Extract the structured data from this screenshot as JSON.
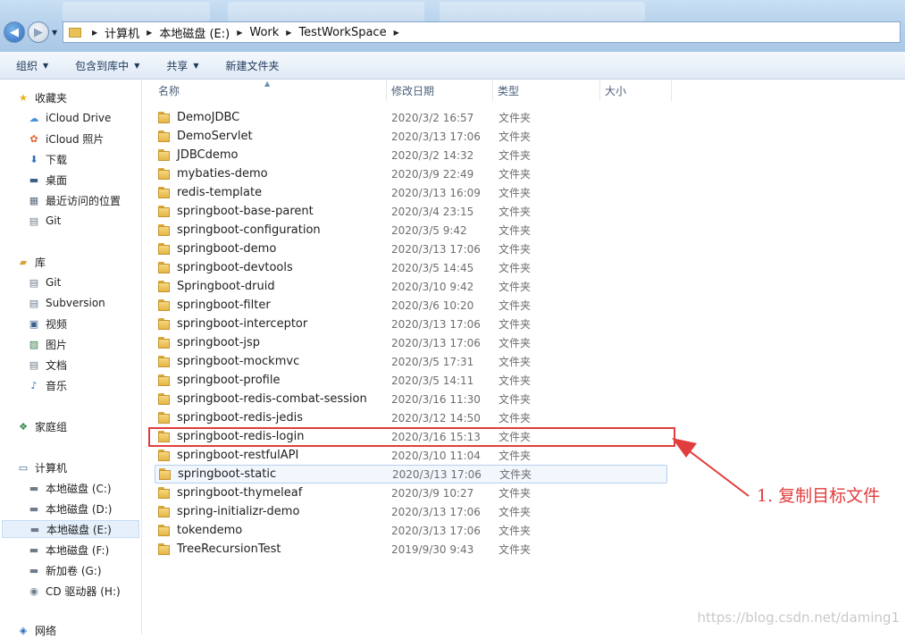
{
  "address_bar": {
    "crumbs": [
      "计算机",
      "本地磁盘 (E:)",
      "Work",
      "TestWorkSpace"
    ]
  },
  "toolbar": {
    "organize": "组织",
    "include_in_library": "包含到库中",
    "share": "共享",
    "new_folder": "新建文件夹"
  },
  "sidebar": {
    "favorites": {
      "label": "收藏夹",
      "items": [
        "iCloud Drive",
        "iCloud 照片",
        "下载",
        "桌面",
        "最近访问的位置",
        "Git"
      ]
    },
    "libraries": {
      "label": "库",
      "items": [
        "Git",
        "Subversion",
        "视频",
        "图片",
        "文档",
        "音乐"
      ]
    },
    "homegroup": {
      "label": "家庭组"
    },
    "computer": {
      "label": "计算机",
      "items": [
        "本地磁盘 (C:)",
        "本地磁盘 (D:)",
        "本地磁盘 (E:)",
        "本地磁盘 (F:)",
        "新加卷 (G:)",
        "CD 驱动器 (H:)"
      ],
      "selected": "本地磁盘 (E:)"
    },
    "network": {
      "label": "网络"
    }
  },
  "columns": {
    "name": "名称",
    "modified": "修改日期",
    "type": "类型",
    "size": "大小"
  },
  "files": [
    {
      "name": "DemoJDBC",
      "modified": "2020/3/2 16:57",
      "type": "文件夹"
    },
    {
      "name": "DemoServlet",
      "modified": "2020/3/13 17:06",
      "type": "文件夹"
    },
    {
      "name": "JDBCdemo",
      "modified": "2020/3/2 14:32",
      "type": "文件夹"
    },
    {
      "name": "mybaties-demo",
      "modified": "2020/3/9 22:49",
      "type": "文件夹"
    },
    {
      "name": "redis-template",
      "modified": "2020/3/13 16:09",
      "type": "文件夹"
    },
    {
      "name": "springboot-base-parent",
      "modified": "2020/3/4 23:15",
      "type": "文件夹"
    },
    {
      "name": "springboot-configuration",
      "modified": "2020/3/5 9:42",
      "type": "文件夹"
    },
    {
      "name": "springboot-demo",
      "modified": "2020/3/13 17:06",
      "type": "文件夹"
    },
    {
      "name": "springboot-devtools",
      "modified": "2020/3/5 14:45",
      "type": "文件夹"
    },
    {
      "name": "Springboot-druid",
      "modified": "2020/3/10 9:42",
      "type": "文件夹"
    },
    {
      "name": "springboot-filter",
      "modified": "2020/3/6 10:20",
      "type": "文件夹"
    },
    {
      "name": "springboot-interceptor",
      "modified": "2020/3/13 17:06",
      "type": "文件夹"
    },
    {
      "name": "springboot-jsp",
      "modified": "2020/3/13 17:06",
      "type": "文件夹"
    },
    {
      "name": "springboot-mockmvc",
      "modified": "2020/3/5 17:31",
      "type": "文件夹"
    },
    {
      "name": "springboot-profile",
      "modified": "2020/3/5 14:11",
      "type": "文件夹"
    },
    {
      "name": "springboot-redis-combat-session",
      "modified": "2020/3/16 11:30",
      "type": "文件夹"
    },
    {
      "name": "springboot-redis-jedis",
      "modified": "2020/3/12 14:50",
      "type": "文件夹"
    },
    {
      "name": "springboot-redis-login",
      "modified": "2020/3/16 15:13",
      "type": "文件夹"
    },
    {
      "name": "springboot-restfulAPI",
      "modified": "2020/3/10 11:04",
      "type": "文件夹"
    },
    {
      "name": "springboot-static",
      "modified": "2020/3/13 17:06",
      "type": "文件夹"
    },
    {
      "name": "springboot-thymeleaf",
      "modified": "2020/3/9 10:27",
      "type": "文件夹"
    },
    {
      "name": "spring-initializr-demo",
      "modified": "2020/3/13 17:06",
      "type": "文件夹"
    },
    {
      "name": "tokendemo",
      "modified": "2020/3/13 17:06",
      "type": "文件夹"
    },
    {
      "name": "TreeRecursionTest",
      "modified": "2019/9/30 9:43",
      "type": "文件夹"
    }
  ],
  "annotation": {
    "text": "1. 复制目标文件",
    "target": "springboot-redis-login",
    "color": "#e23d3d"
  },
  "watermark": "https://blog.csdn.net/daming1"
}
